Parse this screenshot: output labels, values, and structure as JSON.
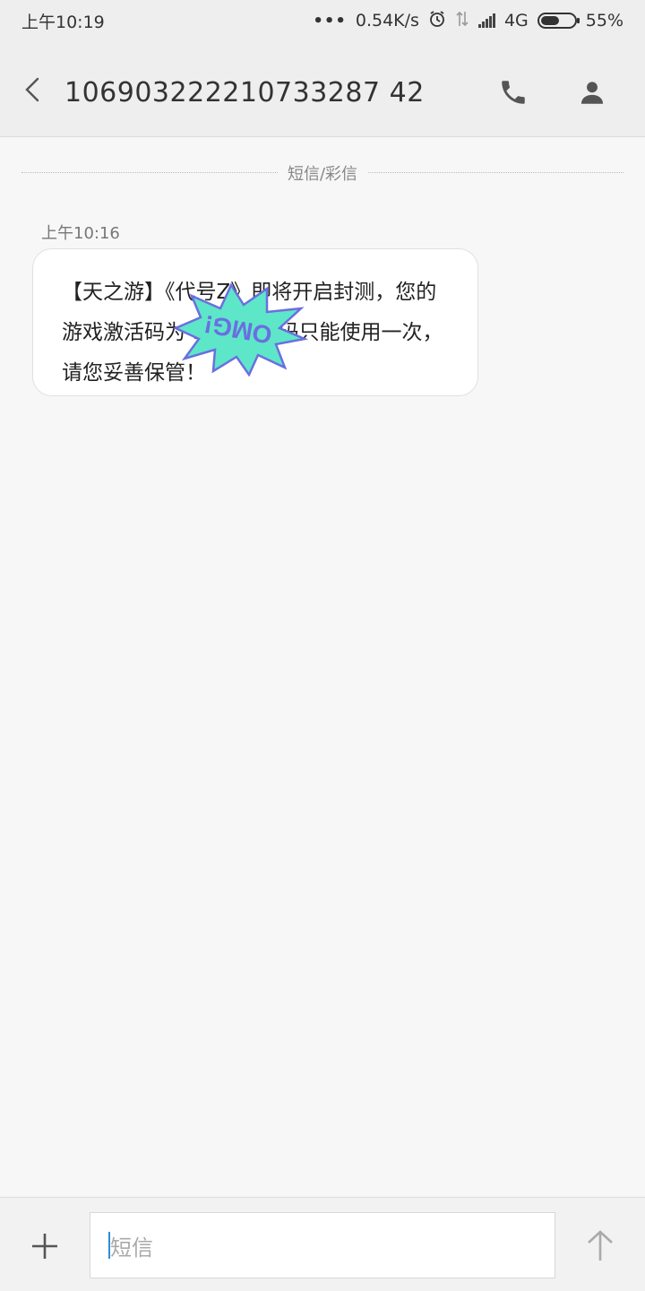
{
  "status_bar": {
    "time": "上午10:19",
    "dots": "•••",
    "speed": "0.54K/s",
    "network": "4G",
    "battery_text": "55%",
    "battery_level": 0.55
  },
  "header": {
    "phone_number": "106903222210733287 42"
  },
  "conversation": {
    "divider_label": "短信/彩信",
    "messages": [
      {
        "time": "上午10:16",
        "text": "【天之游】《代号Z》即将开启封测，您的游戏激活码为          9uy,激活码只能使用一次，请您妥善保管！",
        "sticker_text": "OMG!"
      }
    ]
  },
  "compose": {
    "placeholder": "短信"
  },
  "colors": {
    "sticker_fill": "#5ee6c8",
    "sticker_text": "#6a6fe0",
    "caret": "#2a8fd6"
  }
}
